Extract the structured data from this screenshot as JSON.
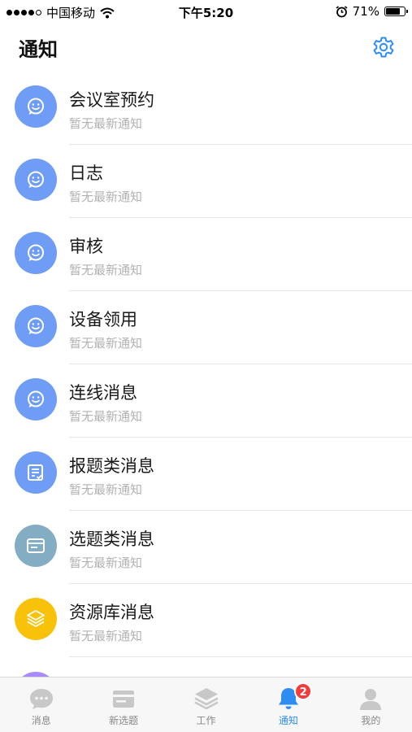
{
  "status_bar": {
    "carrier": "中国移动",
    "time": "下午5:20",
    "battery": "71%",
    "battery_level": 0.71
  },
  "header": {
    "title": "通知"
  },
  "notifications": [
    {
      "title": "会议室预约",
      "subtitle": "暂无最新通知",
      "color": "#6f9cf4",
      "icon": "smiley-chat-icon"
    },
    {
      "title": "日志",
      "subtitle": "暂无最新通知",
      "color": "#6f9cf4",
      "icon": "smiley-chat-icon"
    },
    {
      "title": "审核",
      "subtitle": "暂无最新通知",
      "color": "#6f9cf4",
      "icon": "smiley-chat-icon"
    },
    {
      "title": "设备领用",
      "subtitle": "暂无最新通知",
      "color": "#6f9cf4",
      "icon": "smiley-chat-icon"
    },
    {
      "title": "连线消息",
      "subtitle": "暂无最新通知",
      "color": "#6f9cf4",
      "icon": "smiley-chat-icon"
    },
    {
      "title": "报题类消息",
      "subtitle": "暂无最新通知",
      "color": "#6f9cf4",
      "icon": "checklist-icon"
    },
    {
      "title": "选题类消息",
      "subtitle": "暂无最新通知",
      "color": "#83adc2",
      "icon": "card-icon"
    },
    {
      "title": "资源库消息",
      "subtitle": "暂无最新通知",
      "color": "#f8c20a",
      "icon": "layers-icon"
    }
  ],
  "partial_item": {
    "title": "",
    "color": "#a78bfa"
  },
  "tabbar": {
    "tabs": [
      {
        "label": "消息",
        "icon": "chat-bubble-icon",
        "active": false
      },
      {
        "label": "新选题",
        "icon": "card-stack-icon",
        "active": false
      },
      {
        "label": "工作",
        "icon": "layers-icon",
        "active": false
      },
      {
        "label": "通知",
        "icon": "bell-icon",
        "active": true,
        "badge": "2"
      },
      {
        "label": "我的",
        "icon": "person-icon",
        "active": false
      }
    ]
  },
  "colors": {
    "accent": "#2f8cf0",
    "badge": "#f53b3b"
  }
}
